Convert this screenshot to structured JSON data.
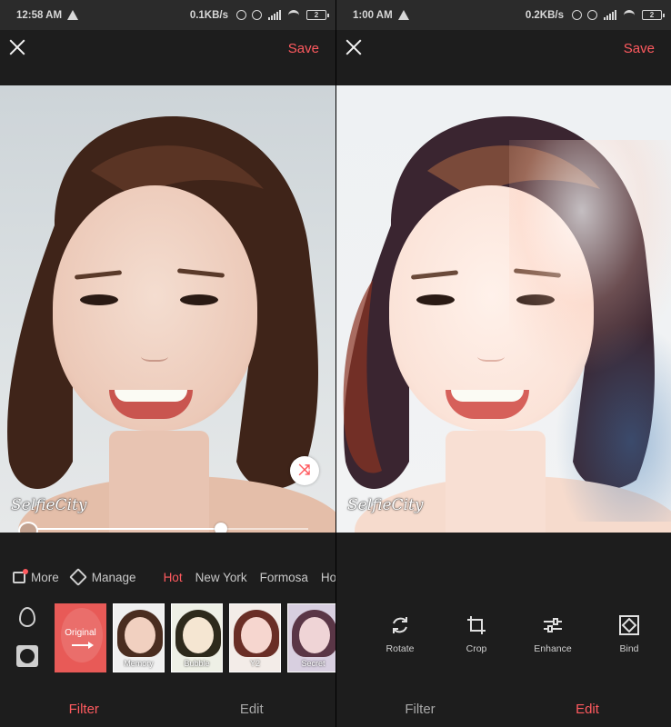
{
  "colors": {
    "accent": "#ff5a5f",
    "background": "#1d1d1d",
    "statusbar": "#2b2b2b"
  },
  "left": {
    "status": {
      "time": "12:58 AM",
      "speed": "0.1KB/s",
      "battery": "2"
    },
    "topbar": {
      "save_label": "Save",
      "close_icon": "close-icon"
    },
    "photo": {
      "watermark": "SelfieCity",
      "slider_value": 0.68
    },
    "categories": {
      "more_label": "More",
      "manage_label": "Manage",
      "items": [
        "Hot",
        "New York",
        "Formosa",
        "Ho"
      ],
      "active": "Hot"
    },
    "thumbnails": [
      {
        "label": "Original"
      },
      {
        "label": "Memory"
      },
      {
        "label": "Bubble"
      },
      {
        "label": "Y2"
      },
      {
        "label": "Secret"
      }
    ],
    "tabs": {
      "filter": "Filter",
      "edit": "Edit",
      "active": "Filter"
    }
  },
  "right": {
    "status": {
      "time": "1:00 AM",
      "speed": "0.2KB/s",
      "battery": "2"
    },
    "topbar": {
      "save_label": "Save",
      "close_icon": "close-icon"
    },
    "photo": {
      "watermark": "SelfieCity"
    },
    "tools": [
      {
        "label": "Rotate",
        "icon": "rotate-icon"
      },
      {
        "label": "Crop",
        "icon": "crop-icon"
      },
      {
        "label": "Enhance",
        "icon": "enhance-icon"
      },
      {
        "label": "Bind",
        "icon": "bind-icon"
      }
    ],
    "tabs": {
      "filter": "Filter",
      "edit": "Edit",
      "active": "Edit"
    }
  }
}
